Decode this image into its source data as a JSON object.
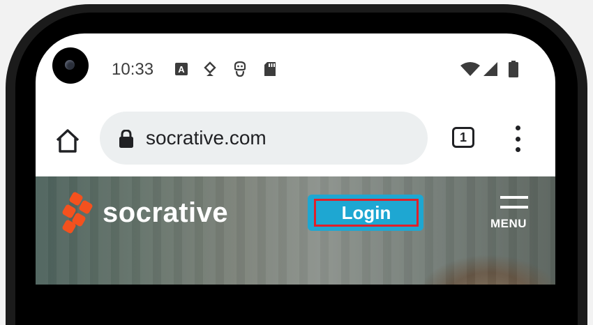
{
  "status_bar": {
    "time": "10:33",
    "notification_icons": [
      "translate-icon",
      "location-icon",
      "accessibility-icon",
      "sd-card-icon"
    ],
    "system_icons": [
      "wifi-icon",
      "signal-icon",
      "battery-icon"
    ]
  },
  "browser": {
    "url": "socrative.com",
    "tab_count": "1",
    "icons": [
      "home-icon",
      "lock-icon",
      "more-options-icon"
    ]
  },
  "site": {
    "brand_name": "socrative",
    "login_label": "Login",
    "menu_label": "MENU",
    "colors": {
      "logo": "#f4511e",
      "login_button": "#1ea7d2",
      "highlight": "#e0202a"
    }
  }
}
